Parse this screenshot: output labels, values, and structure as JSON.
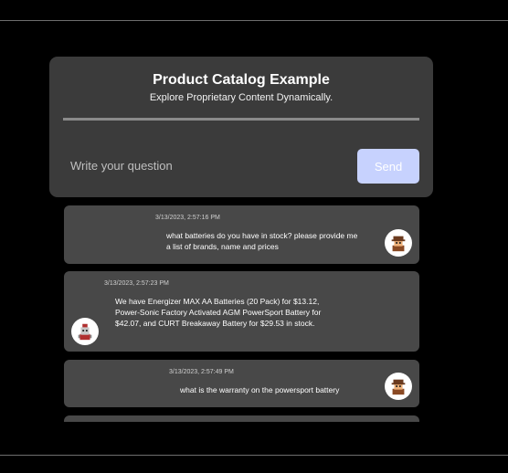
{
  "header": {
    "title": "Product Catalog Example",
    "subtitle": "Explore Proprietary Content Dynamically."
  },
  "question": {
    "placeholder": "Write your question",
    "value": ""
  },
  "send_label": "Send",
  "colors": {
    "background": "#000000",
    "card": "#3b3b3b",
    "message": "#484848",
    "send_button": "#c7d2fe"
  },
  "messages": [
    {
      "sender": "user",
      "timestamp": "3/13/2023, 2:57:16 PM",
      "text": "what batteries do you have in stock? please provide me a list of brands, name and prices",
      "avatar_icon": "user-avatar-icon"
    },
    {
      "sender": "bot",
      "timestamp": "3/13/2023, 2:57:23 PM",
      "text": "We have Energizer MAX AA Batteries (20 Pack) for $13.12, Power-Sonic Factory Activated AGM PowerSport Battery for $42.07, and CURT Breakaway Battery for $29.53 in stock.",
      "avatar_icon": "bot-avatar-icon"
    },
    {
      "sender": "user",
      "timestamp": "3/13/2023, 2:57:49 PM",
      "text": "what is the warranty on the powersport battery",
      "avatar_icon": "user-avatar-icon"
    }
  ]
}
